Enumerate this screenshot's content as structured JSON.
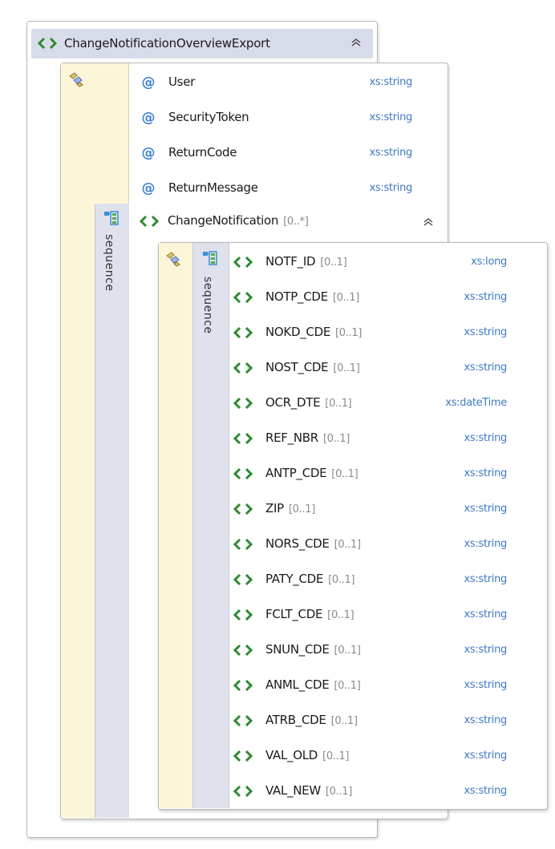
{
  "root": {
    "name": "ChangeNotificationOverviewExport",
    "collapse_glyph": "≈"
  },
  "complex_type_1": {
    "compositor_label": "sequence",
    "attributes": [
      {
        "name": "User",
        "type": "xs:string"
      },
      {
        "name": "SecurityToken",
        "type": "xs:string"
      },
      {
        "name": "ReturnCode",
        "type": "xs:string"
      },
      {
        "name": "ReturnMessage",
        "type": "xs:string"
      }
    ],
    "child_element": {
      "name": "ChangeNotification",
      "cardinality": "[0..*]",
      "collapse_glyph": "≈"
    }
  },
  "complex_type_2": {
    "compositor_label": "sequence",
    "elements": [
      {
        "name": "NOTF_ID",
        "cardinality": "[0..1]",
        "type": "xs:long"
      },
      {
        "name": "NOTP_CDE",
        "cardinality": "[0..1]",
        "type": "xs:string"
      },
      {
        "name": "NOKD_CDE",
        "cardinality": "[0..1]",
        "type": "xs:string"
      },
      {
        "name": "NOST_CDE",
        "cardinality": "[0..1]",
        "type": "xs:string"
      },
      {
        "name": "OCR_DTE",
        "cardinality": "[0..1]",
        "type": "xs:dateTime"
      },
      {
        "name": "REF_NBR",
        "cardinality": "[0..1]",
        "type": "xs:string"
      },
      {
        "name": "ANTP_CDE",
        "cardinality": "[0..1]",
        "type": "xs:string"
      },
      {
        "name": "ZIP",
        "cardinality": "[0..1]",
        "type": "xs:string"
      },
      {
        "name": "NORS_CDE",
        "cardinality": "[0..1]",
        "type": "xs:string"
      },
      {
        "name": "PATY_CDE",
        "cardinality": "[0..1]",
        "type": "xs:string"
      },
      {
        "name": "FCLT_CDE",
        "cardinality": "[0..1]",
        "type": "xs:string"
      },
      {
        "name": "SNUN_CDE",
        "cardinality": "[0..1]",
        "type": "xs:string"
      },
      {
        "name": "ANML_CDE",
        "cardinality": "[0..1]",
        "type": "xs:string"
      },
      {
        "name": "ATRB_CDE",
        "cardinality": "[0..1]",
        "type": "xs:string"
      },
      {
        "name": "VAL_OLD",
        "cardinality": "[0..1]",
        "type": "xs:string"
      },
      {
        "name": "VAL_NEW",
        "cardinality": "[0..1]",
        "type": "xs:string"
      }
    ]
  },
  "colors": {
    "header_bg": "#d8dcea",
    "type_text": "#3f78c4",
    "complex_type_strip": "#fcf6d9",
    "sequence_bar": "#dfe2ec",
    "element_icon": "#2f8a2f",
    "attribute_icon": "#3a7fd6"
  },
  "icons": {
    "element": "element-diamond-icon",
    "attribute": "attribute-at-icon",
    "complex_type": "complex-type-icon",
    "sequence": "sequence-compositor-icon",
    "collapse": "collapse-chevron-icon"
  }
}
